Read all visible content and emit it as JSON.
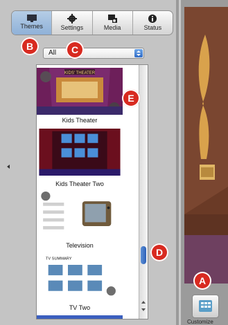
{
  "toolbar": {
    "tabs": [
      {
        "label": "Themes",
        "icon": "monitor-icon",
        "active": true
      },
      {
        "label": "Settings",
        "icon": "gear-icon",
        "active": false
      },
      {
        "label": "Media",
        "icon": "media-icon",
        "active": false
      },
      {
        "label": "Status",
        "icon": "info-icon",
        "active": false
      }
    ]
  },
  "filter": {
    "value": "All"
  },
  "themes": [
    {
      "label": "Kids Theater",
      "thumb_title": "KIDS' THEATER"
    },
    {
      "label": "Kids Theater Two"
    },
    {
      "label": "Television"
    },
    {
      "label": "TV Two",
      "thumb_title": "TV SUMMARY"
    }
  ],
  "customize": {
    "label": "Customize"
  },
  "annotations": [
    "A",
    "B",
    "C",
    "D",
    "E"
  ],
  "colors": {
    "accent": "#3b74cc",
    "badge": "#d82a20"
  }
}
